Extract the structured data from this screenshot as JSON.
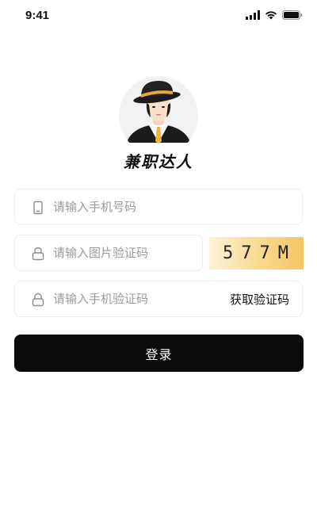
{
  "status_bar": {
    "time": "9:41"
  },
  "brand": {
    "name": "兼职达人"
  },
  "form": {
    "phone_placeholder": "请输入手机号码",
    "captcha_placeholder": "请输入图片验证码",
    "captcha_code": "577M",
    "sms_placeholder": "请输入手机验证码",
    "get_code_label": "获取验证码",
    "login_label": "登录"
  },
  "colors": {
    "primary_button": "#0b0b0b",
    "captcha_gradient_start": "#fdf2d6",
    "captcha_gradient_end": "#f3c566",
    "placeholder": "#9a9a9a"
  },
  "icons": {
    "phone_field": "phone-icon",
    "captcha_field": "lock-icon",
    "sms_field": "lock-icon"
  }
}
